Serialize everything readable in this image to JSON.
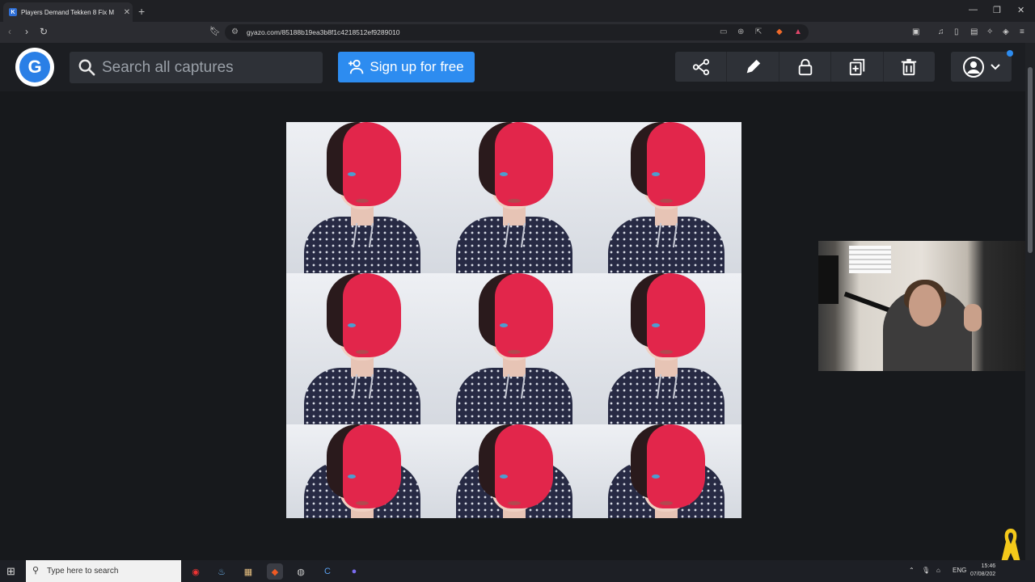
{
  "browser": {
    "tab_title": "Players Demand Tekken 8 Fix M",
    "tab_close": "✕",
    "new_tab": "+",
    "url": "gyazo.com/85188b19ea3b8f1c4218512ef9289010",
    "window_controls": [
      "—",
      "❐",
      "✕"
    ],
    "nav": {
      "back": "‹",
      "forward": "›",
      "reload": "↻"
    }
  },
  "gyazo": {
    "logo_letter": "G",
    "search_placeholder": "Search all captures",
    "signup_label": "Sign up for free",
    "tools": [
      "share-icon",
      "pencil-icon",
      "lock-icon",
      "copy-icon",
      "trash-icon"
    ],
    "accent_color": "#2d8cf0"
  },
  "capture": {
    "grid_rows": 3,
    "grid_cols": 3
  },
  "taskbar": {
    "search_placeholder": "Type here to search",
    "language": "ENG",
    "time": "15:46",
    "date": "07/08/202"
  }
}
